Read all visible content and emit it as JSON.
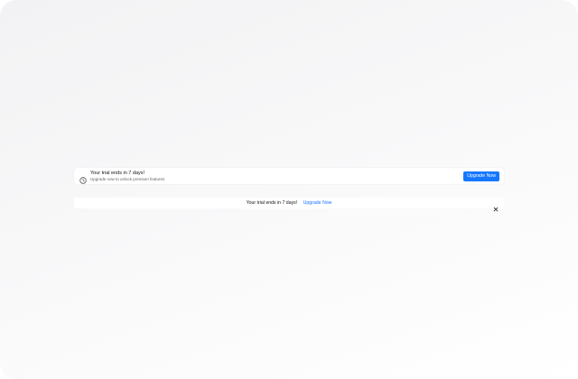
{
  "trial_banner": {
    "title": "Your trial ends in 7 days!",
    "subtitle": "Upgrade now to unlock premium features",
    "cta_label": "Upgrade Now",
    "icon": "clock-icon"
  },
  "trial_bar": {
    "message": "Your trial ends in 7 days!",
    "link_label": "Upgrade Now",
    "close_icon": "close-icon"
  },
  "colors": {
    "accent": "#1677ff",
    "text": "#111111",
    "muted": "#666666"
  }
}
